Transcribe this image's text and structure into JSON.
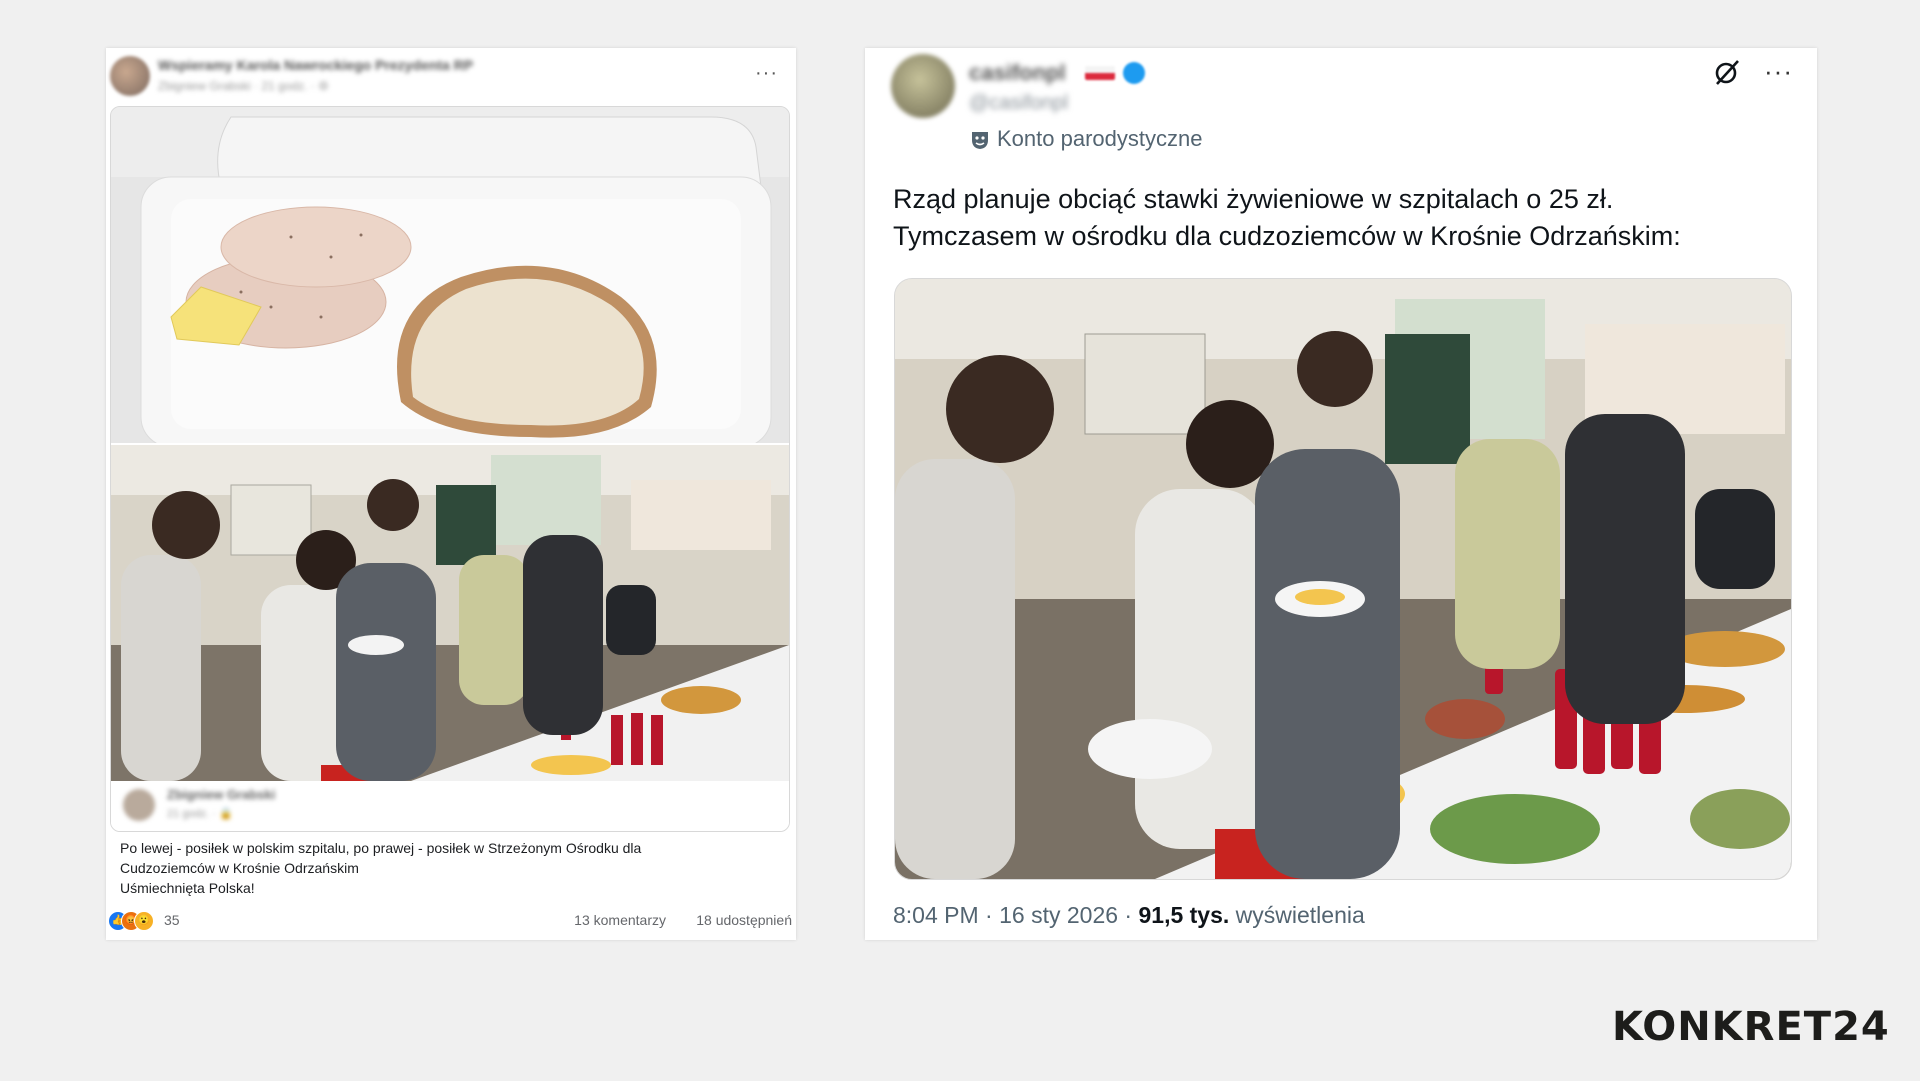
{
  "facebook_post": {
    "author": "Wspieramy Karola Nawrockiego Prezydenta RP",
    "meta": "Zbigniew Grabski · 21 godz. · ⚙",
    "more": "···",
    "comment": {
      "author": "Zbigniew Grabski",
      "meta": "21 godz. · 🔒",
      "lines": [
        "Po lewej - posiłek w polskim szpitalu, po prawej - posiłek w Strzeżonym Ośrodku dla",
        "Cudzoziemców w Krośnie Odrzańskim",
        "Uśmiechnięta Polska!"
      ]
    },
    "reactions_count": "35",
    "comments": "13 komentarzy",
    "shares": "18 udostępnień"
  },
  "tweet": {
    "name": "casifonpl",
    "handle": "@casifonpl",
    "more": "···",
    "parody_label": "Konto parodystyczne",
    "text_line1": "Rząd planuje obciąć stawki żywieniowe w szpitalach o 25 zł.",
    "text_line2": "Tymczasem w ośrodku dla cudzoziemców w Krośnie Odrzańskim:",
    "time": "8:04 PM",
    "date": "16 sty 2026",
    "views": "91,5 tys.",
    "views_label": "wyświetlenia"
  },
  "logo": "KONKRET24",
  "colors": {
    "background": "#f0f0f0",
    "twitter_verified": "#1d9bf0",
    "facebook_like": "#1877f2",
    "coca_cola_red": "#c8102e"
  }
}
